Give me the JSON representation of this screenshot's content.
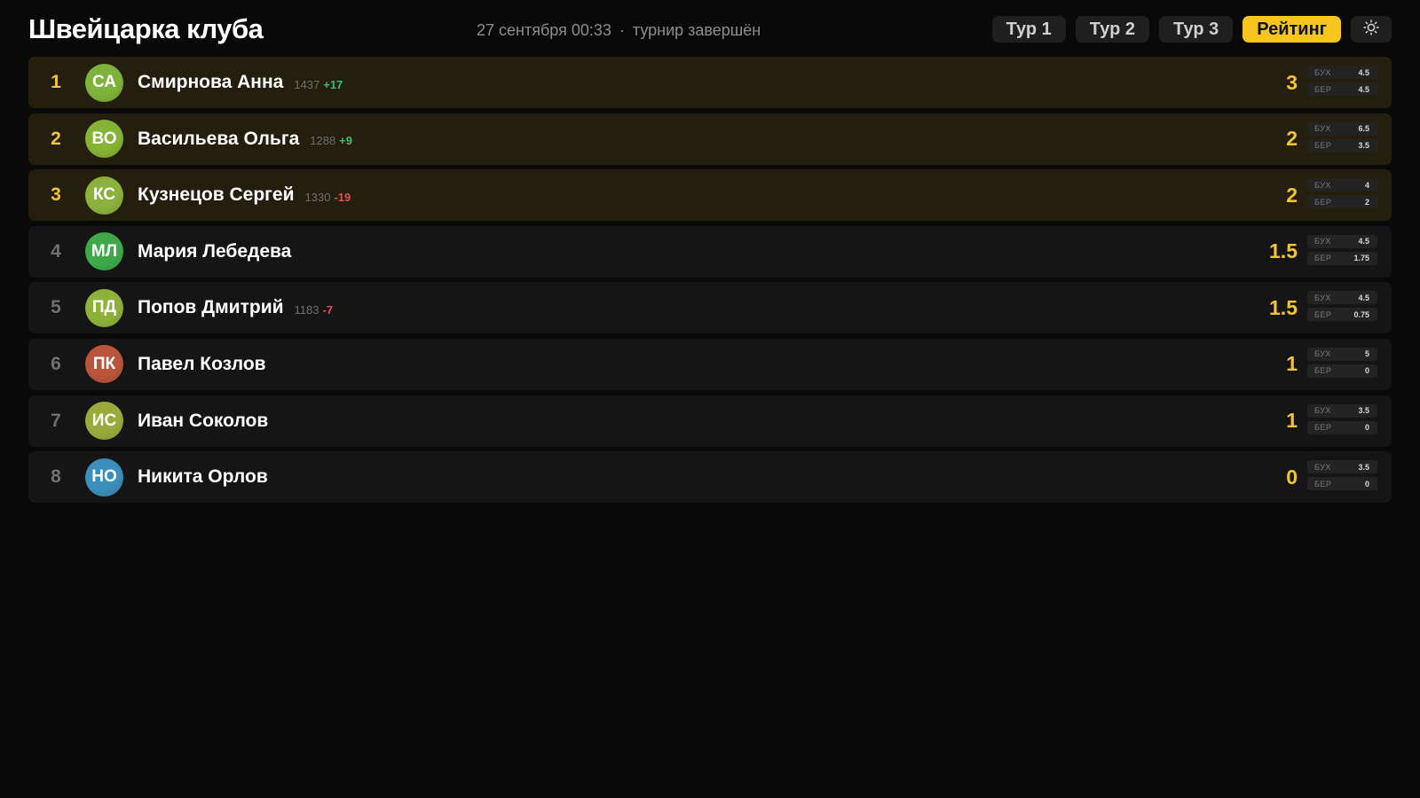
{
  "header": {
    "title": "Швейцарка клуба",
    "date": "27 сентября 00:33",
    "separator": "·",
    "status": "турнир завершён"
  },
  "nav": {
    "tabs": [
      {
        "label": "Тур 1",
        "active": false
      },
      {
        "label": "Тур 2",
        "active": false
      },
      {
        "label": "Тур 3",
        "active": false
      },
      {
        "label": "Рейтинг",
        "active": true
      }
    ],
    "theme_icon": "sun-icon"
  },
  "tiebreak_labels": {
    "buch": "БУХ",
    "berger": "БЕР"
  },
  "colors": {
    "accent": "#f7c51e",
    "top_row_bg": "#231e0e",
    "row_bg": "#151515",
    "delta_positive": "#38c06a",
    "delta_negative": "#e0505a"
  },
  "standings": [
    {
      "rank": "1",
      "initials": "СА",
      "name": "Смирнова Анна",
      "rating": "1437",
      "delta": "+17",
      "score": "3",
      "buch": "4.5",
      "berger": "4.5",
      "avatar_color": "#7fb23a",
      "highlight": true
    },
    {
      "rank": "2",
      "initials": "ВО",
      "name": "Васильева Ольга",
      "rating": "1288",
      "delta": "+9",
      "score": "2",
      "buch": "6.5",
      "berger": "3.5",
      "avatar_color": "#84b335",
      "highlight": true
    },
    {
      "rank": "3",
      "initials": "КС",
      "name": "Кузнецов Сергей",
      "rating": "1330",
      "delta": "-19",
      "score": "2",
      "buch": "4",
      "berger": "2",
      "avatar_color": "#8cb13c",
      "highlight": true
    },
    {
      "rank": "4",
      "initials": "МЛ",
      "name": "Мария Лебедева",
      "rating": "",
      "delta": "",
      "score": "1.5",
      "buch": "4.5",
      "berger": "1.75",
      "avatar_color": "#3ea94a",
      "highlight": false
    },
    {
      "rank": "5",
      "initials": "ПД",
      "name": "Попов Дмитрий",
      "rating": "1183",
      "delta": "-7",
      "score": "1.5",
      "buch": "4.5",
      "berger": "0.75",
      "avatar_color": "#8db23a",
      "highlight": false
    },
    {
      "rank": "6",
      "initials": "ПК",
      "name": "Павел Козлов",
      "rating": "",
      "delta": "",
      "score": "1",
      "buch": "5",
      "berger": "0",
      "avatar_color": "#b8553a",
      "highlight": false
    },
    {
      "rank": "7",
      "initials": "ИС",
      "name": "Иван Соколов",
      "rating": "",
      "delta": "",
      "score": "1",
      "buch": "3.5",
      "berger": "0",
      "avatar_color": "#9aab3c",
      "highlight": false
    },
    {
      "rank": "8",
      "initials": "НО",
      "name": "Никита Орлов",
      "rating": "",
      "delta": "",
      "score": "0",
      "buch": "3.5",
      "berger": "0",
      "avatar_color": "#3b8fba",
      "highlight": false
    }
  ]
}
